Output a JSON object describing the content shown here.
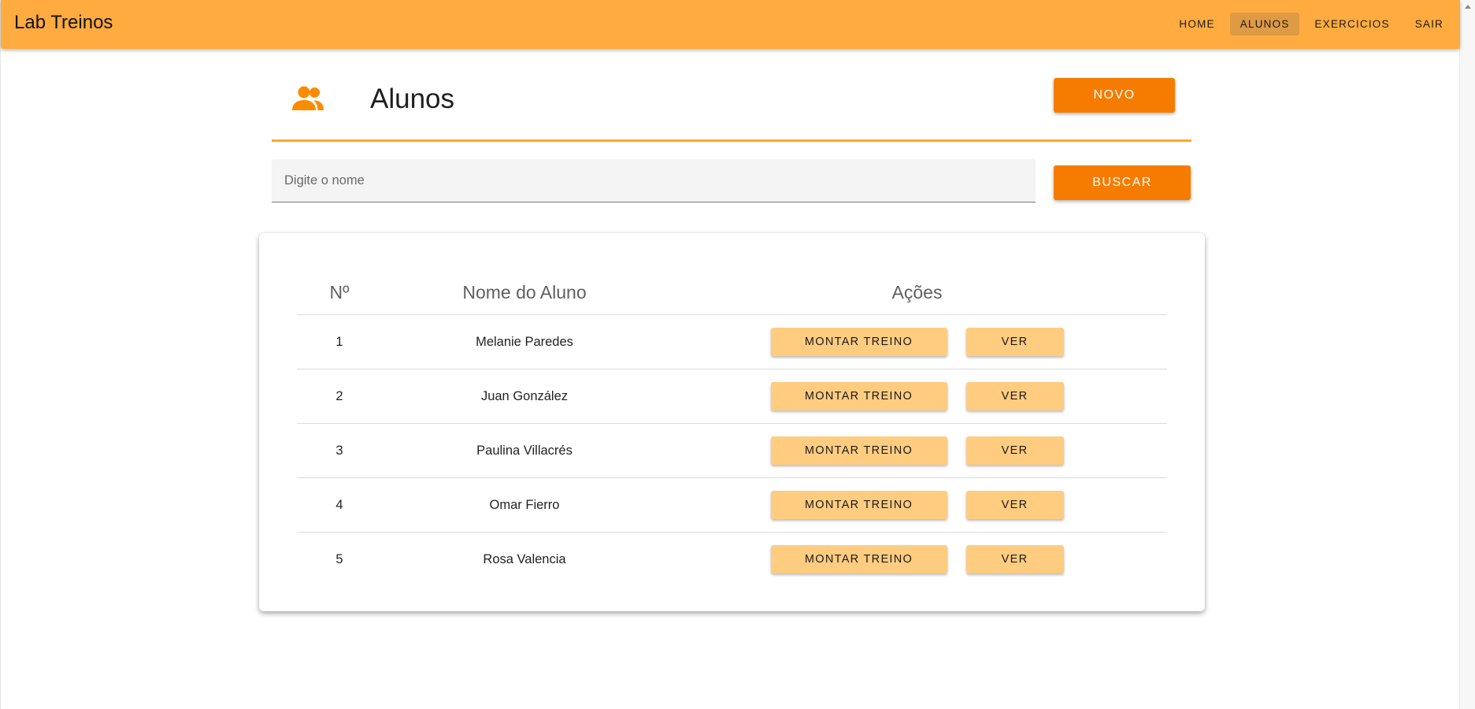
{
  "appbar": {
    "brand": "Lab Treinos",
    "nav": [
      {
        "label": "HOME",
        "active": false
      },
      {
        "label": "ALUNOS",
        "active": true
      },
      {
        "label": "EXERCICIOS",
        "active": false
      },
      {
        "label": "SAIR",
        "active": false
      }
    ]
  },
  "header": {
    "icon": "people-icon",
    "title": "Alunos",
    "new_button": "NOVO"
  },
  "search": {
    "placeholder": "Digite o nome",
    "value": "",
    "button": "BUSCAR"
  },
  "table": {
    "columns": [
      "Nº",
      "Nome do Aluno",
      "Ações"
    ],
    "rows": [
      {
        "num": "1",
        "name": "Melanie Paredes",
        "action_primary": "MONTAR TREINO",
        "action_secondary": "VER"
      },
      {
        "num": "2",
        "name": "Juan González",
        "action_primary": "MONTAR TREINO",
        "action_secondary": "VER"
      },
      {
        "num": "3",
        "name": "Paulina Villacrés",
        "action_primary": "MONTAR TREINO",
        "action_secondary": "VER"
      },
      {
        "num": "4",
        "name": "Omar Fierro",
        "action_primary": "MONTAR TREINO",
        "action_secondary": "VER"
      },
      {
        "num": "5",
        "name": "Rosa Valencia",
        "action_primary": "MONTAR TREINO",
        "action_secondary": "VER"
      }
    ]
  },
  "colors": {
    "appbar": "#ffab40",
    "nav_active": "#de9a44",
    "primary_button": "#f57c00",
    "secondary_button": "#ffcc80",
    "accent_line": "#ffa726",
    "icon": "#fb8c00"
  }
}
